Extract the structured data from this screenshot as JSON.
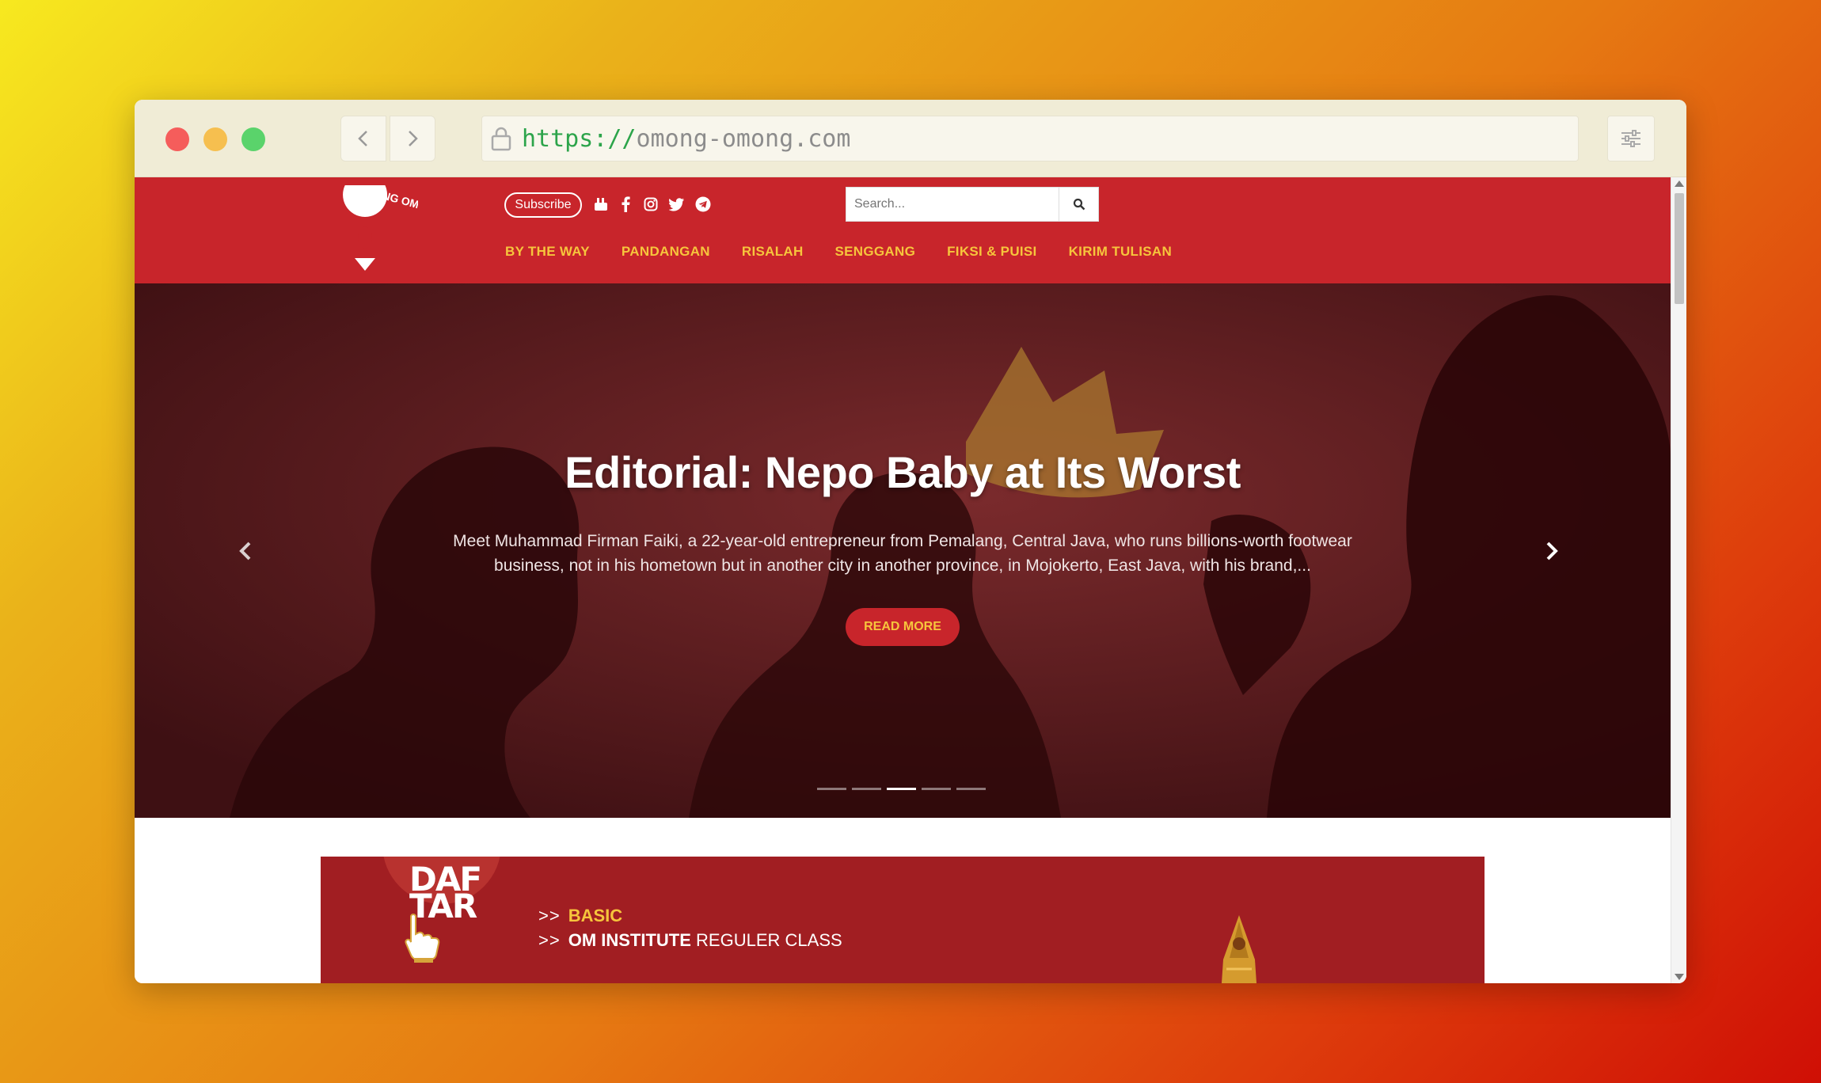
{
  "browser": {
    "url_scheme": "https://",
    "url_host": "omong-omong.com"
  },
  "site": {
    "logo_text": "OMONG OMONG",
    "subscribe_label": "Subscribe",
    "social_icons": [
      "youtube-icon",
      "facebook-icon",
      "instagram-icon",
      "twitter-icon",
      "telegram-icon"
    ],
    "search_placeholder": "Search...",
    "nav": [
      "BY THE WAY",
      "PANDANGAN",
      "RISALAH",
      "SENGGANG",
      "FIKSI & PUISI",
      "KIRIM TULISAN"
    ],
    "colors": {
      "header_red": "#c8252b",
      "accent_yellow": "#f6c53c"
    }
  },
  "hero": {
    "title": "Editorial: Nepo Baby at Its Worst",
    "excerpt": "Meet Muhammad Firman Faiki, a 22-year-old entrepreneur from Pemalang, Central Java, who runs billions-worth footwear business, not in his hometown but in another city in another province, in Mojokerto, East Java, with his brand,...",
    "read_more_label": "READ MORE",
    "slide_count": 5,
    "active_slide": 3
  },
  "banner": {
    "badge_text_1": "DAF",
    "badge_text_2": "TAR",
    "line1_prefix": ">>",
    "line1_highlight": "BASIC",
    "line2_prefix": ">>",
    "line2_bold": "OM INSTITUTE",
    "line2_rest": "REGULER CLASS"
  }
}
